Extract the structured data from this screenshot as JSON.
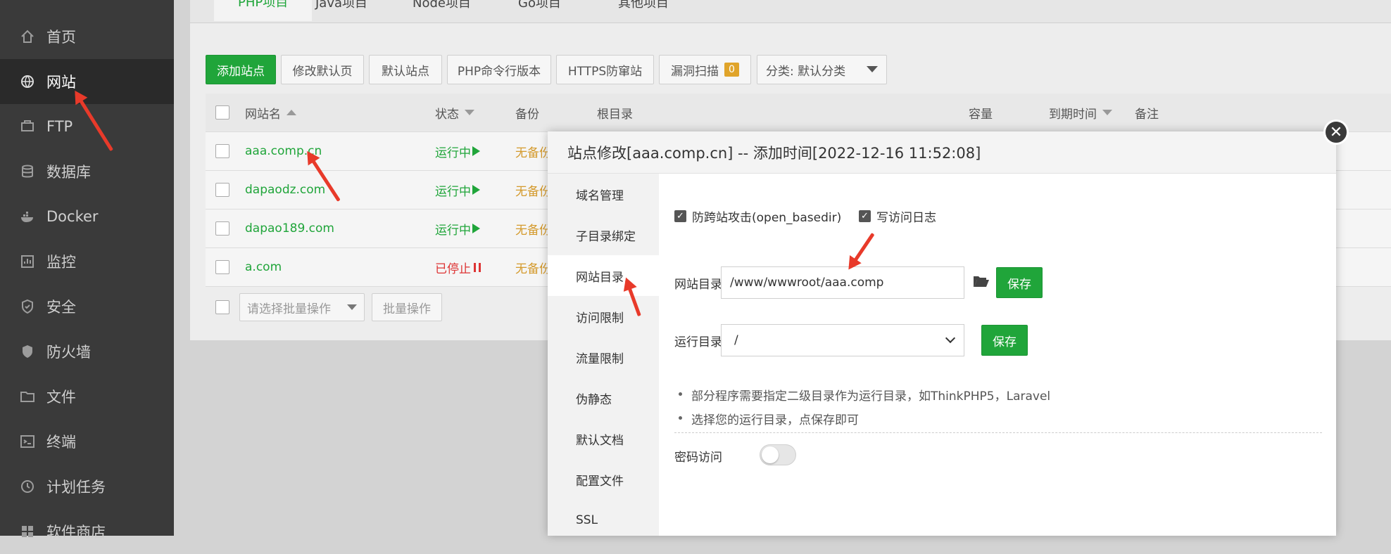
{
  "sidebar": {
    "items": [
      {
        "label": "首页",
        "icon": "home-icon"
      },
      {
        "label": "网站",
        "icon": "globe-icon"
      },
      {
        "label": "FTP",
        "icon": "ftp-icon"
      },
      {
        "label": "数据库",
        "icon": "database-icon"
      },
      {
        "label": "Docker",
        "icon": "docker-icon"
      },
      {
        "label": "监控",
        "icon": "monitor-icon"
      },
      {
        "label": "安全",
        "icon": "shield-icon"
      },
      {
        "label": "防火墙",
        "icon": "firewall-icon"
      },
      {
        "label": "文件",
        "icon": "folder-icon"
      },
      {
        "label": "终端",
        "icon": "terminal-icon"
      },
      {
        "label": "计划任务",
        "icon": "clock-icon"
      },
      {
        "label": "软件商店",
        "icon": "grid-icon"
      }
    ]
  },
  "tabs": [
    "PHP项目",
    "Java项目",
    "Node项目",
    "Go项目",
    "其他项目"
  ],
  "toolbar": {
    "add_site": "添加站点",
    "modify_default": "修改默认页",
    "default_site": "默认站点",
    "php_cli": "PHP命令行版本",
    "https_guard": "HTTPS防窜站",
    "vuln_scan": "漏洞扫描",
    "vuln_count": "0",
    "category": "分类: 默认分类"
  },
  "table": {
    "headers": {
      "name": "网站名",
      "status": "状态",
      "backup": "备份",
      "root": "根目录",
      "capacity": "容量",
      "expire": "到期时间",
      "note": "备注"
    },
    "rows": [
      {
        "name": "aaa.comp.cn",
        "status": "运行中",
        "backup": "无备份"
      },
      {
        "name": "dapaodz.com",
        "status": "运行中",
        "backup": "无备份"
      },
      {
        "name": "dapao189.com",
        "status": "运行中",
        "backup": "无备份"
      },
      {
        "name": "a.com",
        "status": "已停止",
        "backup": "无备份"
      }
    ],
    "batch_placeholder": "请选择批量操作",
    "batch_button": "批量操作"
  },
  "modal": {
    "title": "站点修改[aaa.comp.cn] -- 添加时间[2022-12-16 11:52:08]",
    "nav": [
      "域名管理",
      "子目录绑定",
      "网站目录",
      "访问限制",
      "流量限制",
      "伪静态",
      "默认文档",
      "配置文件",
      "SSL"
    ],
    "open_basedir_label": "防跨站攻击(open_basedir)",
    "access_log_label": "写访问日志",
    "site_dir_label": "网站目录",
    "site_dir_value": "/www/wwwroot/aaa.comp",
    "save_label": "保存",
    "run_dir_label": "运行目录",
    "run_dir_value": "/",
    "tips": [
      "部分程序需要指定二级目录作为运行目录，如ThinkPHP5，Laravel",
      "选择您的运行目录，点保存即可"
    ],
    "password_access_label": "密码访问"
  },
  "colors": {
    "accent": "#20a53a",
    "sidebar_bg": "#3a3a3a",
    "annotation": "#e83a2a"
  }
}
